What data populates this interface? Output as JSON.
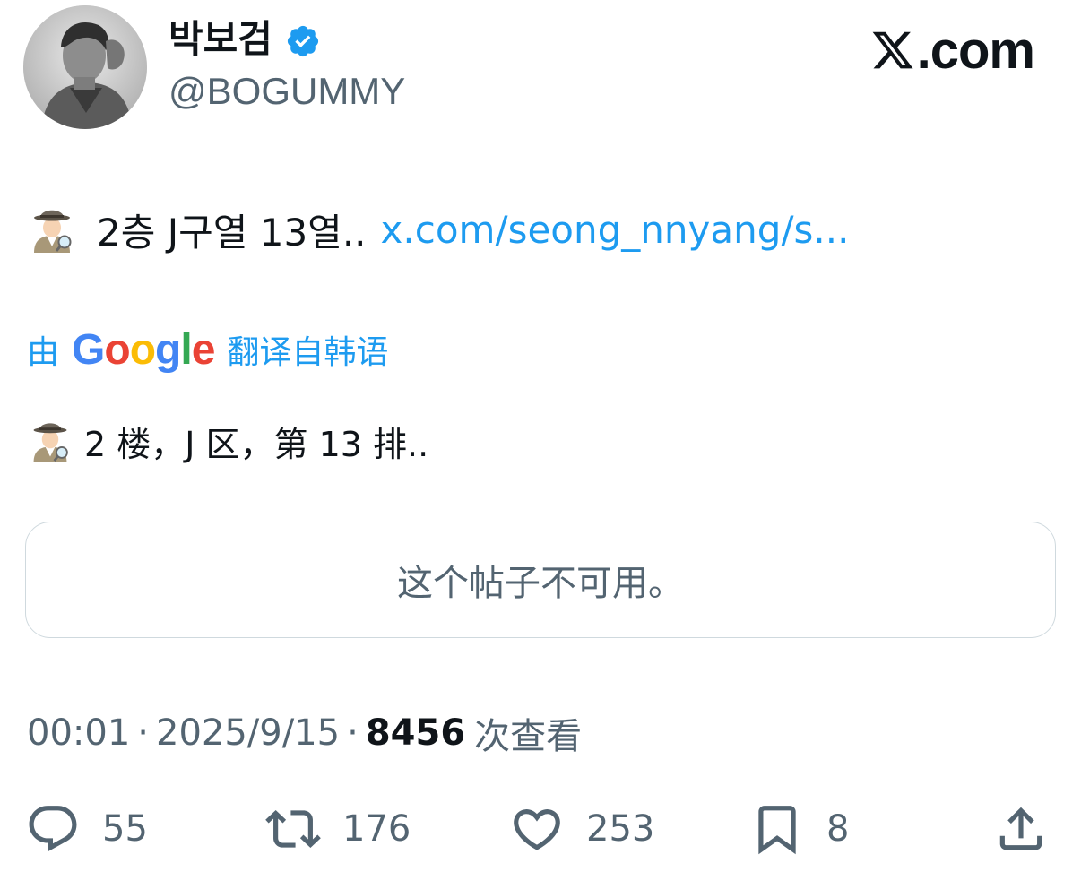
{
  "author": {
    "display_name": "박보검",
    "handle": "@BOGUMMY",
    "verified": true
  },
  "brand": {
    "text": ".com",
    "icon": "x-logo-icon"
  },
  "tweet": {
    "emoji": "detective-emoji",
    "text": "2층 J구열 13열..",
    "link": "x.com/seong_nnyang/s..."
  },
  "translation": {
    "prefix": "由",
    "provider": "Google",
    "suffix": "翻译自韩语",
    "text": "2 楼，J 区，第 13 排.."
  },
  "quote_card": {
    "text": "这个帖子不可用。"
  },
  "meta": {
    "time": "00:01",
    "separator": "·",
    "date": "2025/9/15",
    "views_count": "8456",
    "views_label": "次查看"
  },
  "actions": {
    "replies": "55",
    "reposts": "176",
    "likes": "253",
    "bookmarks": "8"
  },
  "colors": {
    "link_blue": "#1d9bf0",
    "verified_blue": "#1d9bf0",
    "secondary_text": "#536471",
    "primary_text": "#0f1419",
    "card_border": "#cfd9de"
  }
}
